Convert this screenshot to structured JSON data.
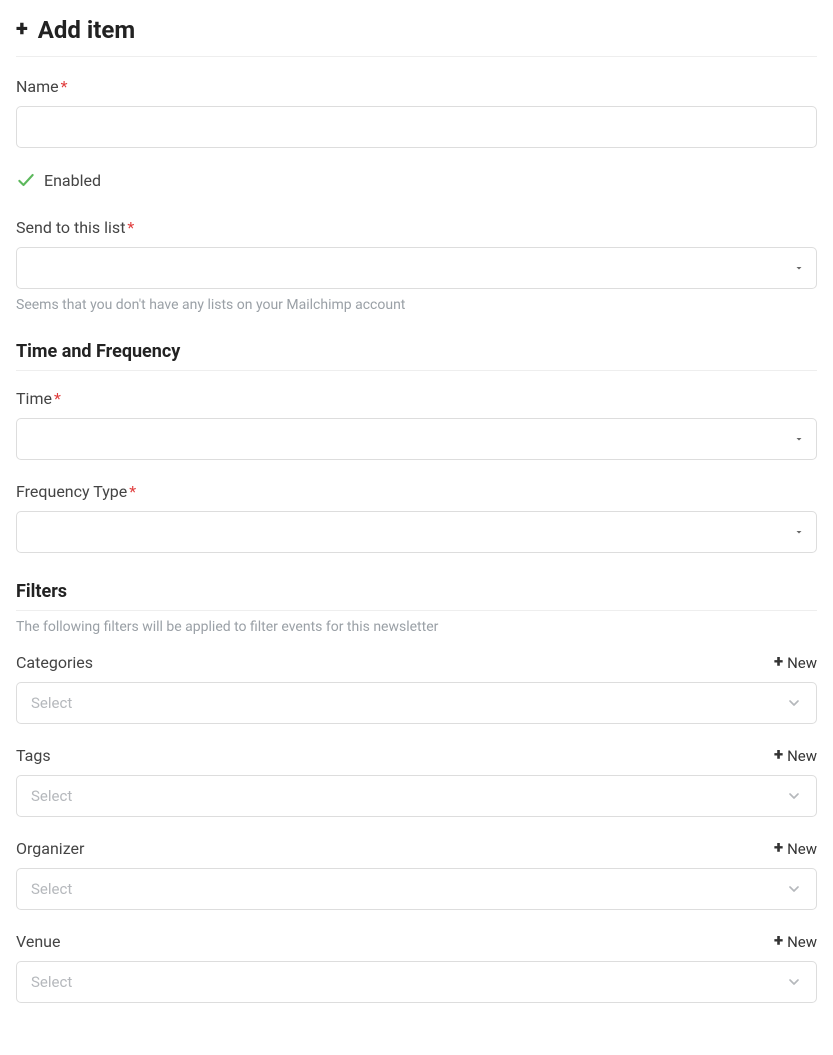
{
  "header": {
    "title": "Add item"
  },
  "fields": {
    "name": {
      "label": "Name",
      "value": ""
    },
    "enabled": {
      "label": "Enabled",
      "checked": true
    },
    "send_to_list": {
      "label": "Send to this list",
      "value": "",
      "help": "Seems that you don't have any lists on your Mailchimp account"
    },
    "time": {
      "label": "Time",
      "value": ""
    },
    "frequency_type": {
      "label": "Frequency Type",
      "value": ""
    }
  },
  "sections": {
    "time_frequency": {
      "title": "Time and Frequency"
    },
    "filters": {
      "title": "Filters",
      "subtext": "The following filters will be applied to filter events for this newsletter"
    }
  },
  "filters": {
    "categories": {
      "label": "Categories",
      "new_label": "New",
      "placeholder": "Select"
    },
    "tags": {
      "label": "Tags",
      "new_label": "New",
      "placeholder": "Select"
    },
    "organizer": {
      "label": "Organizer",
      "new_label": "New",
      "placeholder": "Select"
    },
    "venue": {
      "label": "Venue",
      "new_label": "New",
      "placeholder": "Select"
    }
  }
}
